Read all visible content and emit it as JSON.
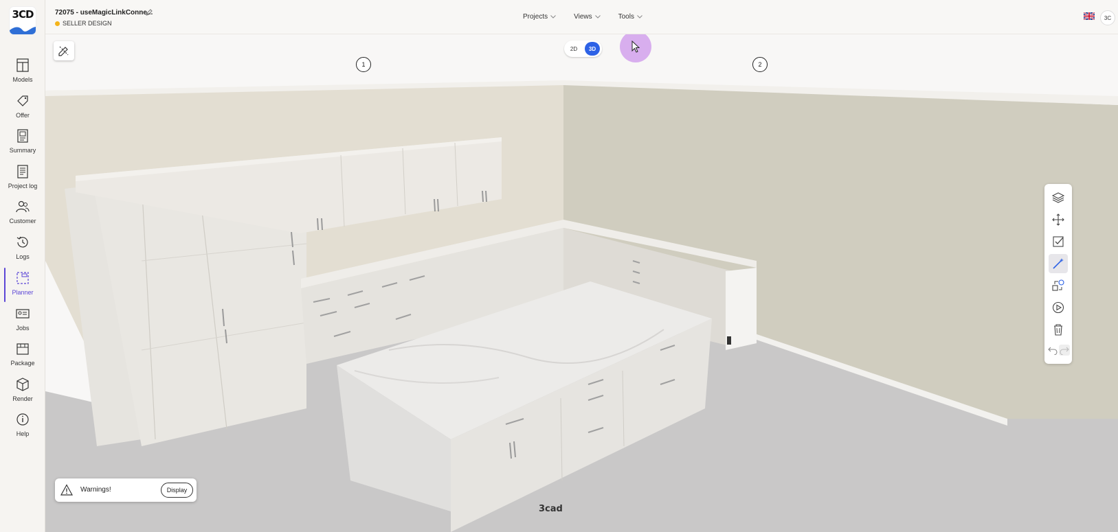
{
  "brand": {
    "logo_text": "3CD"
  },
  "sidebar": {
    "items": [
      {
        "id": "models",
        "label": "Models",
        "icon": "models-icon"
      },
      {
        "id": "offer",
        "label": "Offer",
        "icon": "tag-icon"
      },
      {
        "id": "summary",
        "label": "Summary",
        "icon": "summary-icon"
      },
      {
        "id": "project-log",
        "label": "Project log",
        "icon": "document-icon"
      },
      {
        "id": "customer",
        "label": "Customer",
        "icon": "users-icon"
      },
      {
        "id": "logs",
        "label": "Logs",
        "icon": "history-icon"
      },
      {
        "id": "planner",
        "label": "Planner",
        "icon": "planner-icon",
        "active": true
      },
      {
        "id": "jobs",
        "label": "Jobs",
        "icon": "jobs-icon"
      },
      {
        "id": "package",
        "label": "Package",
        "icon": "package-icon"
      },
      {
        "id": "render",
        "label": "Render",
        "icon": "cube-icon"
      },
      {
        "id": "help",
        "label": "Help",
        "icon": "info-icon"
      }
    ]
  },
  "header": {
    "project_title": "72075 - useMagicLinkConne...",
    "status": "SELLER DESIGN",
    "status_color": "#f4b41a",
    "menu": [
      {
        "label": "Projects"
      },
      {
        "label": "Views"
      },
      {
        "label": "Tools"
      }
    ],
    "language": "en-GB",
    "user_initials": "3C"
  },
  "viewport": {
    "view_modes": {
      "option_2d": "2D",
      "option_3d": "3D",
      "selected": "3D"
    },
    "wall_markers": [
      "1",
      "2"
    ],
    "accent_color": "#2d62e6",
    "right_toolbar": [
      {
        "icon": "layers-icon"
      },
      {
        "icon": "move-icon"
      },
      {
        "icon": "checkbox-icon"
      },
      {
        "icon": "magic-wand-icon",
        "active": true
      },
      {
        "icon": "swap-icon"
      },
      {
        "icon": "play-icon"
      },
      {
        "icon": "trash-icon"
      },
      {
        "icon": "undo-icon"
      },
      {
        "icon": "redo-icon"
      }
    ],
    "warnings": {
      "label": "Warnings!",
      "button": "Display"
    },
    "watermark": "3cad"
  }
}
